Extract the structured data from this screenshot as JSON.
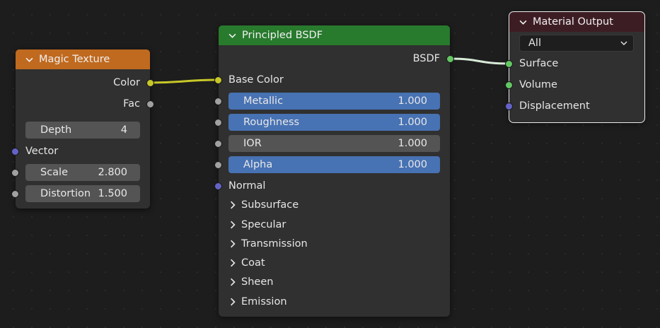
{
  "magic_texture": {
    "title": "Magic Texture",
    "outputs": {
      "color": "Color",
      "fac": "Fac"
    },
    "depth": {
      "label": "Depth",
      "value": "4"
    },
    "vector": "Vector",
    "scale": {
      "label": "Scale",
      "value": "2.800"
    },
    "distortion": {
      "label": "Distortion",
      "value": "1.500"
    }
  },
  "principled_bsdf": {
    "title": "Principled BSDF",
    "output": "BSDF",
    "base_color": "Base Color",
    "metallic": {
      "label": "Metallic",
      "value": "1.000"
    },
    "roughness": {
      "label": "Roughness",
      "value": "1.000"
    },
    "ior": {
      "label": "IOR",
      "value": "1.000"
    },
    "alpha": {
      "label": "Alpha",
      "value": "1.000"
    },
    "normal": "Normal",
    "panels": [
      "Subsurface",
      "Specular",
      "Transmission",
      "Coat",
      "Sheen",
      "Emission"
    ]
  },
  "material_output": {
    "title": "Material Output",
    "target": "All",
    "inputs": {
      "surface": "Surface",
      "volume": "Volume",
      "displacement": "Displacement"
    }
  },
  "colors": {
    "background": "#1d1d1d",
    "node_body": "#303030",
    "texture_header": "#c06a1f",
    "shader_header": "#287a2d",
    "output_header": "#3d1d24",
    "field_blue": "#4772b3",
    "field_gray": "#545454",
    "socket_yellow": "#c7c729",
    "socket_gray": "#a1a1a1",
    "socket_blue": "#6363c7",
    "socket_green": "#63c763"
  }
}
